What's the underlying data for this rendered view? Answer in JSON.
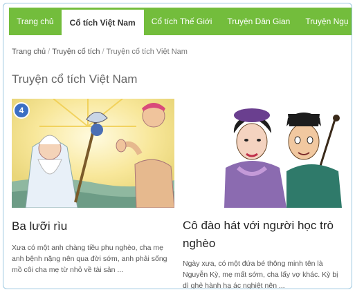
{
  "nav": {
    "items": [
      {
        "label": "Trang chủ",
        "active": false
      },
      {
        "label": "Cổ tích Việt Nam",
        "active": true
      },
      {
        "label": "Cổ tích Thế Giới",
        "active": false
      },
      {
        "label": "Truyện Dân Gian",
        "active": false
      },
      {
        "label": "Truyện Ngụ Ngôn",
        "active": false
      }
    ]
  },
  "breadcrumb": {
    "items": [
      "Trang chủ",
      "Truyện cổ tích",
      "Truyện cổ tích Việt Nam"
    ]
  },
  "page": {
    "title": "Truyện cổ tích Việt Nam"
  },
  "cards": [
    {
      "badge": "4",
      "title": "Ba lưỡi rìu",
      "excerpt": "Xưa có một anh chàng tiều phu nghèo, cha mẹ anh bệnh nặng nên qua đời sớm, anh phải sống mồ côi cha mẹ từ nhỏ về tài sản ..."
    },
    {
      "title": "Cô đào hát với người học trò nghèo",
      "excerpt": "Ngày xưa, có một đứa bé thông minh tên là Nguyễn Kỳ, mẹ mất sớm, cha lấy vợ khác. Kỳ bị dì ghẻ hành hạ ác nghiệt nên ..."
    }
  ],
  "colors": {
    "nav_bg": "#73bd3c",
    "badge": "#3b6fc4"
  }
}
